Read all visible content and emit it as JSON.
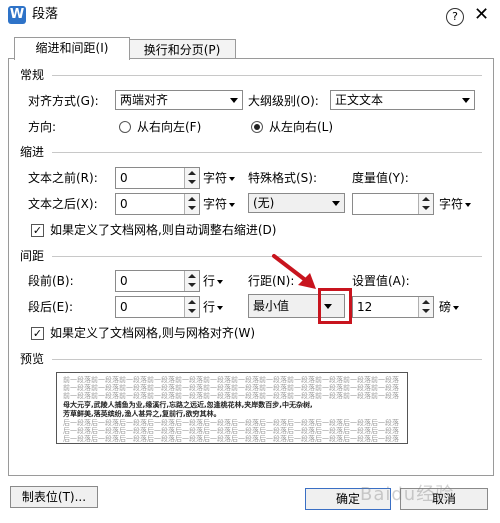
{
  "window": {
    "title": "段落",
    "app_icon_letter": "W",
    "help": "?",
    "close": "✕"
  },
  "tabs": [
    {
      "label": "缩进和间距(I)",
      "active": true
    },
    {
      "label": "换行和分页(P)",
      "active": false
    }
  ],
  "general": {
    "title": "常规",
    "align_label": "对齐方式(G):",
    "align_value": "两端对齐",
    "outline_label": "大纲级别(O):",
    "outline_value": "正文文本",
    "direction_label": "方向:",
    "rtl_label": "从右向左(F)",
    "ltr_label": "从左向右(L)",
    "direction_selected": "ltr"
  },
  "indent": {
    "title": "缩进",
    "before_label": "文本之前(R):",
    "before_value": "0",
    "before_unit": "字符",
    "after_label": "文本之后(X):",
    "after_value": "0",
    "after_unit": "字符",
    "special_label": "特殊格式(S):",
    "special_value": "(无)",
    "measure_label": "度量值(Y):",
    "measure_value": "",
    "measure_unit": "字符",
    "grid_check_label": "如果定义了文档网格,则自动调整右缩进(D)",
    "grid_checked": true
  },
  "spacing": {
    "title": "间距",
    "before_label": "段前(B):",
    "before_value": "0",
    "before_unit": "行",
    "after_label": "段后(E):",
    "after_value": "0",
    "after_unit": "行",
    "line_label": "行距(N):",
    "line_value": "最小值",
    "setting_label": "设置值(A):",
    "setting_value": "12",
    "setting_unit": "磅",
    "grid_check_label": "如果定义了文档网格,则与网格对齐(W)",
    "grid_checked": true
  },
  "preview": {
    "title": "预览",
    "lines": [
      "前一段落前一段落前一段落前一段落前一段落前一段落前一段落前一段落前一段落前一段落前一段落前一段落",
      "前一段落前一段落前一段落前一段落前一段落前一段落前一段落前一段落前一段落前一段落前一段落前一段落",
      "前一段落前一段落前一段落前一段落前一段落前一段落前一段落前一段落前一段落前一段落前一段落前一段落",
      "母大元亨,武陵人捕鱼为业,缘溪行,忘路之远近,忽逢桃花林,夹岸数百步,中无杂树,",
      "芳草鲜美,落英缤纷,渔人甚异之,复前行,欲穷其林。",
      "后一段落后一段落后一段落后一段落后一段落后一段落后一段落后一段落后一段落后一段落后一段落后一段落",
      "后一段落后一段落后一段落后一段落后一段落后一段落后一段落后一段落后一段落后一段落后一段落后一段落",
      "后一段落后一段落后一段落后一段落后一段落后一段落后一段落后一段落后一段落后一段落后一段落后一段落"
    ]
  },
  "buttons": {
    "tabs": "制表位(T)...",
    "ok": "确定",
    "cancel": "取消"
  },
  "colors": {
    "accent": "#2e73c8",
    "highlight": "#c8141e"
  },
  "watermark": "Baidu经验"
}
